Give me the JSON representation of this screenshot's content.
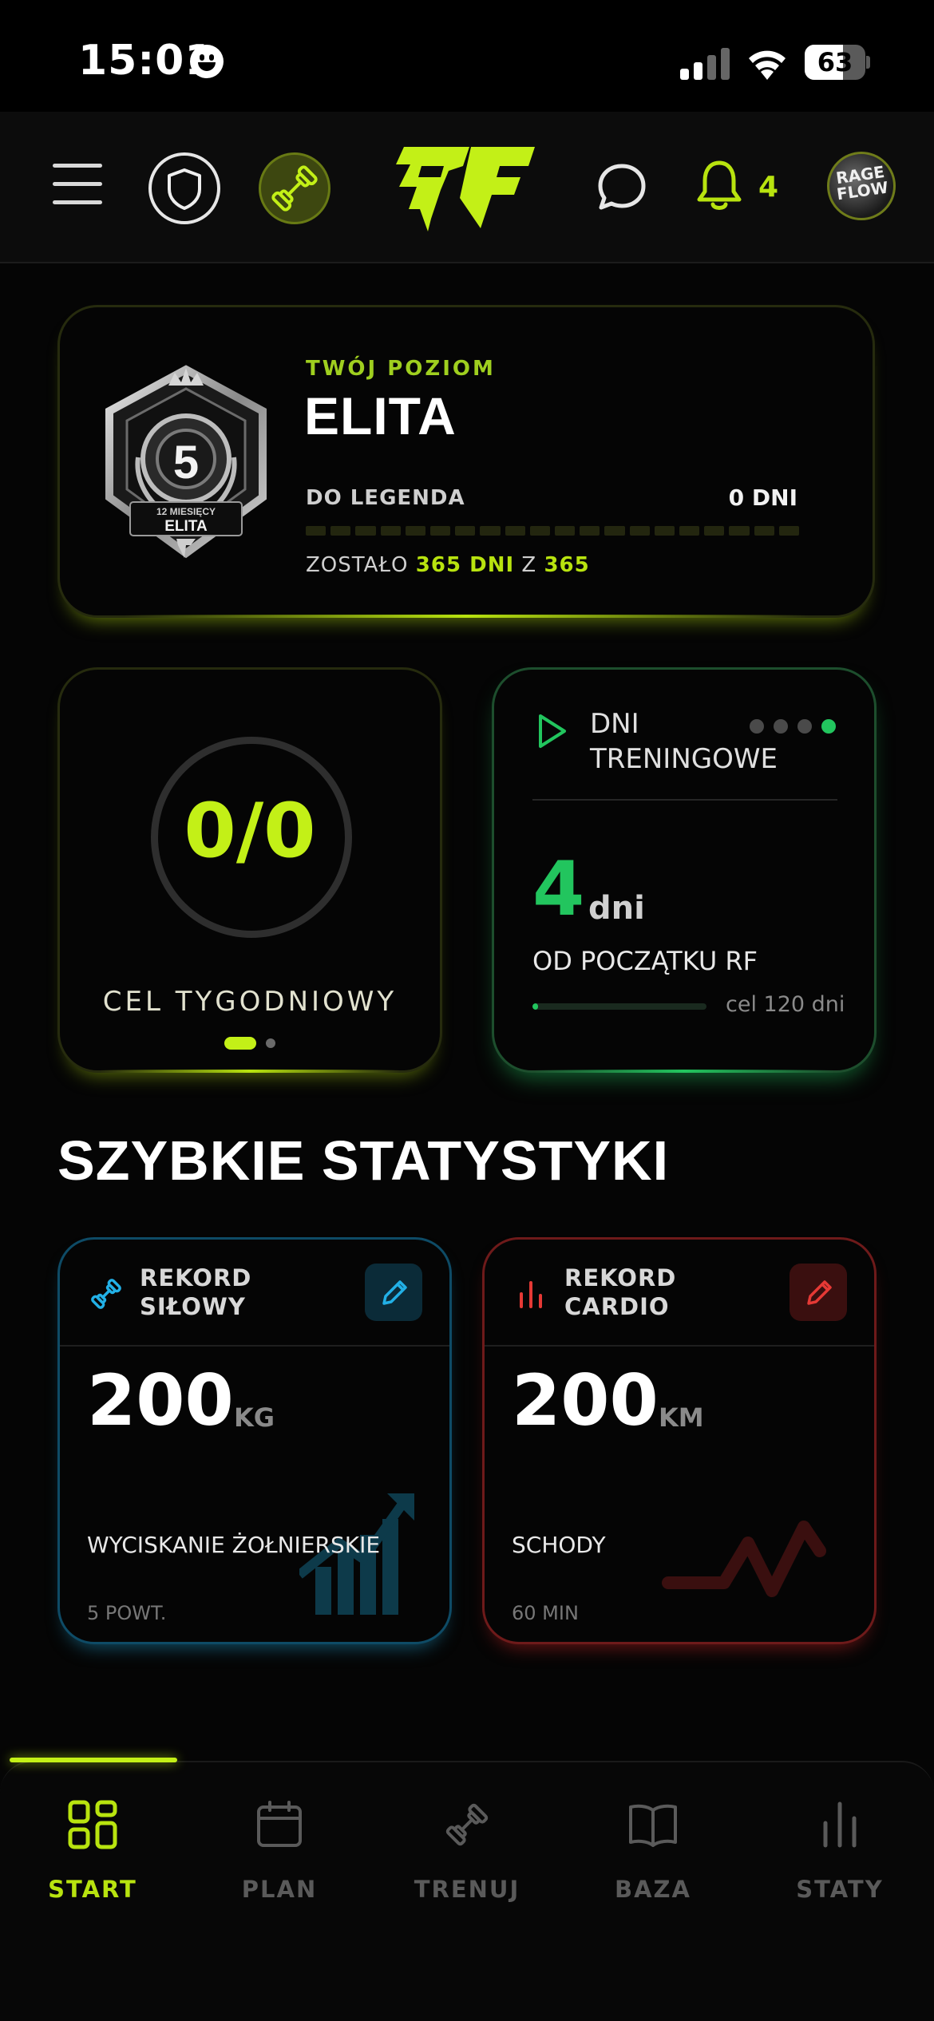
{
  "status_bar": {
    "time": "15:01",
    "battery_percent": "63"
  },
  "header": {
    "logo": "RF",
    "notification_count": "4",
    "avatar_text": "RAGE FLOW"
  },
  "level": {
    "caption": "TWÓJ POZIOM",
    "name": "ELITA",
    "badge_number": "5",
    "badge_subtitle": "12 MIESIĘCY",
    "badge_name": "ELITA",
    "next_label": "DO LEGENDA",
    "next_days": "0 DNI",
    "remaining_prefix": "ZOSTAŁO",
    "remaining_days": "365 DNI",
    "remaining_sep": "Z",
    "remaining_total": "365"
  },
  "weekly_goal": {
    "value": "0/0",
    "label": "CEL TYGODNIOWY"
  },
  "training_days": {
    "title_line1": "DNI",
    "title_line2": "TRENINGOWE",
    "count": "4",
    "unit": "dni",
    "since": "OD POCZĄTKU RF",
    "goal": "cel 120 dni",
    "progress": 0.033
  },
  "quick_stats": {
    "title": "SZYBKIE STATYSTYKI",
    "strength": {
      "title_line1": "REKORD",
      "title_line2": "SIŁOWY",
      "value": "200",
      "unit": "KG",
      "exercise": "WYCISKANIE ŻOŁNIERSKIE",
      "detail": "5 POWT."
    },
    "cardio": {
      "title_line1": "REKORD",
      "title_line2": "CARDIO",
      "value": "200",
      "unit": "KM",
      "exercise": "SCHODY",
      "detail": "60 MIN"
    }
  },
  "nav": {
    "items": [
      {
        "label": "START"
      },
      {
        "label": "PLAN"
      },
      {
        "label": "TRENUJ"
      },
      {
        "label": "BAZA"
      },
      {
        "label": "STATY"
      }
    ]
  },
  "colors": {
    "accent": "#b8e30f",
    "green": "#22c55e",
    "blue": "#22b0e6",
    "red": "#e53935"
  }
}
